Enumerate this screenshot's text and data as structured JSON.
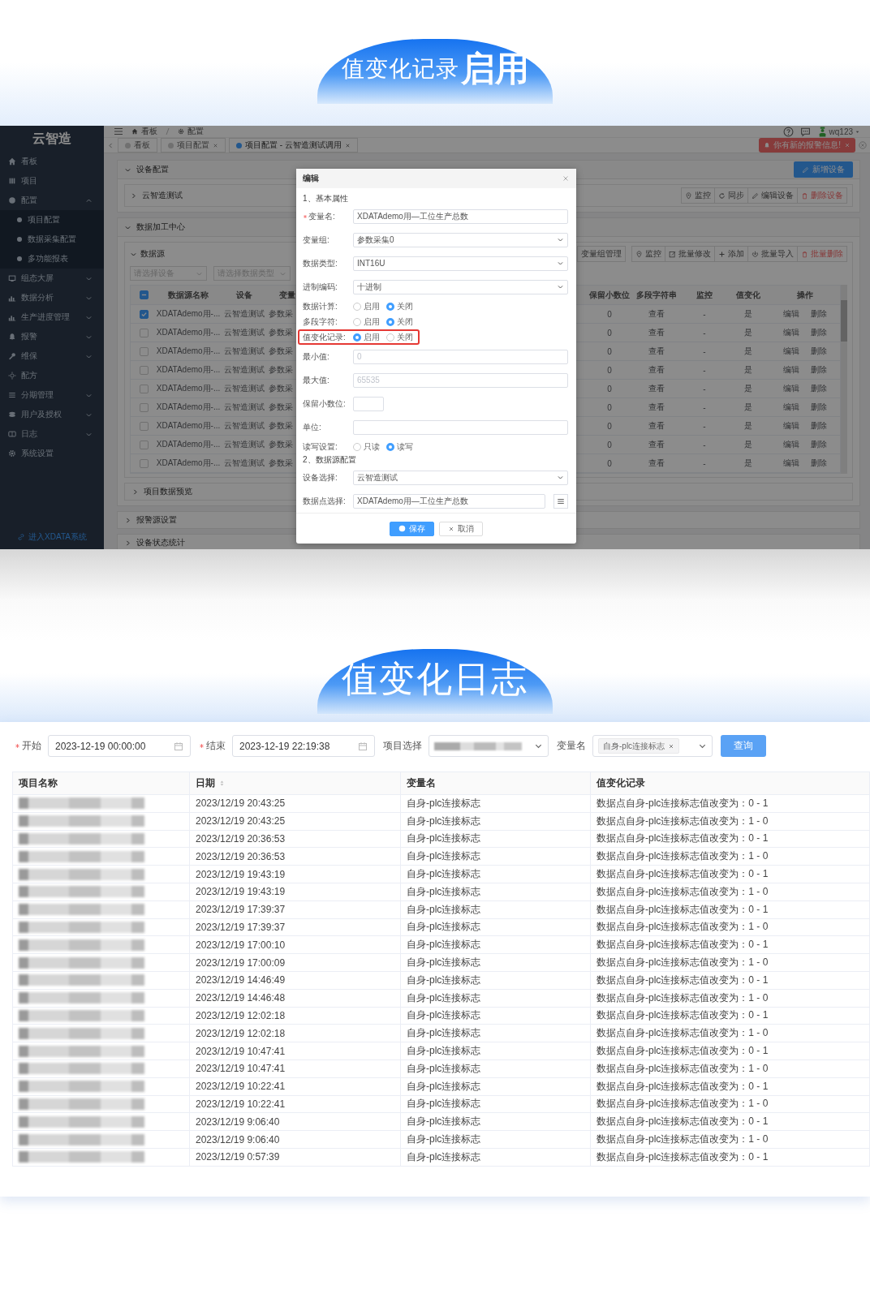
{
  "banner_top": {
    "title": "值变化记录",
    "emphasis": "启用"
  },
  "app": {
    "sidebar": {
      "logo": "云智造",
      "items": [
        {
          "label": "看板"
        },
        {
          "label": "项目"
        },
        {
          "label": "配置",
          "expanded": true,
          "children": [
            {
              "label": "项目配置"
            },
            {
              "label": "数据采集配置"
            },
            {
              "label": "多功能报表"
            }
          ]
        },
        {
          "label": "组态大屏",
          "expanded": false
        },
        {
          "label": "数据分析",
          "expanded": false
        },
        {
          "label": "生产进度管理",
          "expanded": false
        },
        {
          "label": "报警",
          "expanded": false
        },
        {
          "label": "维保",
          "expanded": false
        },
        {
          "label": "配方"
        },
        {
          "label": "分期管理",
          "expanded": false
        },
        {
          "label": "用户及授权",
          "expanded": false
        },
        {
          "label": "日志",
          "expanded": false
        },
        {
          "label": "系统设置"
        }
      ],
      "footer_link": "进入XDATA系统"
    },
    "breadcrumb": [
      "看板",
      "配置"
    ],
    "user": "wq123",
    "tabs": [
      {
        "label": "看板",
        "selected": false,
        "closable": false
      },
      {
        "label": "项目配置",
        "selected": false,
        "closable": true
      },
      {
        "label": "项目配置 - 云智造测试调用",
        "selected": true,
        "closable": true
      }
    ],
    "alert": "你有新的报警信息!",
    "device_section": {
      "title": "设备配置",
      "expanded": true,
      "button": "新增设备",
      "device": "云智造测试",
      "actions": [
        {
          "label": "监控",
          "kind": "normal"
        },
        {
          "label": "同步",
          "kind": "normal"
        },
        {
          "label": "编辑设备",
          "kind": "normal"
        },
        {
          "label": "删除设备",
          "kind": "danger"
        }
      ]
    },
    "data_section": {
      "title": "数据加工中心",
      "expanded": true,
      "source_title": "数据源",
      "group_button": "变量组管理",
      "actions": [
        {
          "label": "监控",
          "kind": "normal"
        },
        {
          "label": "批量修改",
          "kind": "normal"
        },
        {
          "label": "添加",
          "kind": "normal"
        },
        {
          "label": "批量导入",
          "kind": "normal"
        },
        {
          "label": "批量删除",
          "kind": "danger"
        }
      ],
      "header_indeterminate": true,
      "filters": [
        {
          "placeholder": "请选择设备"
        },
        {
          "placeholder": "请选择数据类型"
        }
      ],
      "columns_left": [
        "数据源名称",
        "设备",
        "变量"
      ],
      "columns_right": [
        "保留小数位",
        "多段字符串",
        "监控",
        "值变化",
        "操作"
      ],
      "rows": [
        {
          "selected": true,
          "name": "XDATAdemo用-...",
          "device": "云智造测试",
          "group": "参数采",
          "decimals": "0",
          "multi": "查看",
          "monitor": "-",
          "change": "是",
          "actions": [
            "编辑",
            "删除"
          ]
        },
        {
          "selected": false,
          "name": "XDATAdemo用-...",
          "device": "云智造测试",
          "group": "参数采",
          "decimals": "0",
          "multi": "查看",
          "monitor": "-",
          "change": "是",
          "actions": [
            "编辑",
            "删除"
          ]
        },
        {
          "selected": false,
          "name": "XDATAdemo用-...",
          "device": "云智造测试",
          "group": "参数采",
          "decimals": "0",
          "multi": "查看",
          "monitor": "-",
          "change": "是",
          "actions": [
            "编辑",
            "删除"
          ]
        },
        {
          "selected": false,
          "name": "XDATAdemo用-...",
          "device": "云智造测试",
          "group": "参数采",
          "decimals": "0",
          "multi": "查看",
          "monitor": "-",
          "change": "是",
          "actions": [
            "编辑",
            "删除"
          ]
        },
        {
          "selected": false,
          "name": "XDATAdemo用-...",
          "device": "云智造测试",
          "group": "参数采",
          "decimals": "0",
          "multi": "查看",
          "monitor": "-",
          "change": "是",
          "actions": [
            "编辑",
            "删除"
          ]
        },
        {
          "selected": false,
          "name": "XDATAdemo用-...",
          "device": "云智造测试",
          "group": "参数采",
          "decimals": "0",
          "multi": "查看",
          "monitor": "-",
          "change": "是",
          "actions": [
            "编辑",
            "删除"
          ]
        },
        {
          "selected": false,
          "name": "XDATAdemo用-...",
          "device": "云智造测试",
          "group": "参数采",
          "decimals": "0",
          "multi": "查看",
          "monitor": "-",
          "change": "是",
          "actions": [
            "编辑",
            "删除"
          ]
        },
        {
          "selected": false,
          "name": "XDATAdemo用-...",
          "device": "云智造测试",
          "group": "参数采",
          "decimals": "0",
          "multi": "查看",
          "monitor": "-",
          "change": "是",
          "actions": [
            "编辑",
            "删除"
          ]
        },
        {
          "selected": false,
          "name": "XDATAdemo用-...",
          "device": "云智造测试",
          "group": "参数采",
          "decimals": "0",
          "multi": "查看",
          "monitor": "-",
          "change": "是",
          "actions": [
            "编辑",
            "删除"
          ]
        }
      ],
      "preview": "项目数据预览"
    },
    "collapsed_sections": [
      "报警源设置",
      "设备状态统计"
    ],
    "dialog": {
      "title": "编辑",
      "sections": [
        {
          "title": "1、基本属性",
          "fields": [
            {
              "kind": "input",
              "label": "变量名:",
              "required": true,
              "highlighted": false,
              "value": "XDATAdemo用—工位生产总数"
            },
            {
              "kind": "select",
              "label": "变量组:",
              "required": false,
              "highlighted": false,
              "value": "参数采集0"
            },
            {
              "kind": "select",
              "label": "数据类型:",
              "required": false,
              "highlighted": false,
              "value": "INT16U"
            },
            {
              "kind": "select",
              "label": "进制编码:",
              "required": false,
              "highlighted": false,
              "value": "十进制"
            },
            {
              "kind": "radio",
              "label": "数据计算:",
              "required": false,
              "highlighted": false,
              "options": [
                {
                  "label": "启用",
                  "selected": false
                },
                {
                  "label": "关闭",
                  "selected": true
                }
              ]
            },
            {
              "kind": "radio",
              "label": "多段字符:",
              "required": false,
              "highlighted": false,
              "options": [
                {
                  "label": "启用",
                  "selected": false
                },
                {
                  "label": "关闭",
                  "selected": true
                }
              ]
            },
            {
              "kind": "radio",
              "label": "值变化记录:",
              "required": false,
              "highlighted": true,
              "options": [
                {
                  "label": "启用",
                  "selected": true
                },
                {
                  "label": "关闭",
                  "selected": false
                }
              ]
            },
            {
              "kind": "input",
              "label": "最小值:",
              "required": false,
              "highlighted": false,
              "placeholder": "0"
            },
            {
              "kind": "input",
              "label": "最大值:",
              "required": false,
              "highlighted": false,
              "placeholder": "65535"
            },
            {
              "kind": "short_input",
              "label": "保留小数位:",
              "required": false,
              "highlighted": false
            },
            {
              "kind": "input",
              "label": "单位:",
              "required": false,
              "highlighted": false
            },
            {
              "kind": "radio",
              "label": "读写设置:",
              "required": false,
              "highlighted": false,
              "options": [
                {
                  "label": "只读",
                  "selected": false
                },
                {
                  "label": "读写",
                  "selected": true
                }
              ]
            }
          ]
        },
        {
          "title": "2、数据源配置",
          "fields": [
            {
              "kind": "select",
              "label": "设备选择:",
              "required": false,
              "highlighted": false,
              "value": "云智造测试"
            },
            {
              "kind": "picker",
              "label": "数据点选择:",
              "required": false,
              "highlighted": false,
              "value": "XDATAdemo用—工位生产总数"
            }
          ]
        }
      ],
      "buttons": [
        {
          "label": "保存",
          "kind": "primary"
        },
        {
          "label": "取消",
          "kind": "cancel"
        }
      ]
    }
  },
  "banner_bottom": {
    "title": "值变化日志"
  },
  "log": {
    "filters": [
      {
        "kind": "date",
        "label": "开始",
        "required": true,
        "value": "2023-12-19 00:00:00"
      },
      {
        "kind": "date",
        "label": "结束",
        "required": true,
        "value": "2023-12-19 22:19:38"
      },
      {
        "kind": "select",
        "label": "项目选择",
        "required": false
      },
      {
        "kind": "tags",
        "label": "变量名",
        "required": false,
        "tags": [
          "自身-plc连接标志"
        ]
      }
    ],
    "query_button": "查询",
    "columns": [
      {
        "label": "项目名称",
        "sortable": false
      },
      {
        "label": "日期",
        "sortable": true
      },
      {
        "label": "变量名",
        "sortable": false
      },
      {
        "label": "值变化记录",
        "sortable": false
      }
    ],
    "rows": [
      {
        "date": "2023/12/19 20:43:25",
        "variable": "自身-plc连接标志",
        "record": "数据点自身-plc连接标志值改变为：0 - 1"
      },
      {
        "date": "2023/12/19 20:43:25",
        "variable": "自身-plc连接标志",
        "record": "数据点自身-plc连接标志值改变为：1 - 0"
      },
      {
        "date": "2023/12/19 20:36:53",
        "variable": "自身-plc连接标志",
        "record": "数据点自身-plc连接标志值改变为：0 - 1"
      },
      {
        "date": "2023/12/19 20:36:53",
        "variable": "自身-plc连接标志",
        "record": "数据点自身-plc连接标志值改变为：1 - 0"
      },
      {
        "date": "2023/12/19 19:43:19",
        "variable": "自身-plc连接标志",
        "record": "数据点自身-plc连接标志值改变为：0 - 1"
      },
      {
        "date": "2023/12/19 19:43:19",
        "variable": "自身-plc连接标志",
        "record": "数据点自身-plc连接标志值改变为：1 - 0"
      },
      {
        "date": "2023/12/19 17:39:37",
        "variable": "自身-plc连接标志",
        "record": "数据点自身-plc连接标志值改变为：0 - 1"
      },
      {
        "date": "2023/12/19 17:39:37",
        "variable": "自身-plc连接标志",
        "record": "数据点自身-plc连接标志值改变为：1 - 0"
      },
      {
        "date": "2023/12/19 17:00:10",
        "variable": "自身-plc连接标志",
        "record": "数据点自身-plc连接标志值改变为：0 - 1"
      },
      {
        "date": "2023/12/19 17:00:09",
        "variable": "自身-plc连接标志",
        "record": "数据点自身-plc连接标志值改变为：1 - 0"
      },
      {
        "date": "2023/12/19 14:46:49",
        "variable": "自身-plc连接标志",
        "record": "数据点自身-plc连接标志值改变为：0 - 1"
      },
      {
        "date": "2023/12/19 14:46:48",
        "variable": "自身-plc连接标志",
        "record": "数据点自身-plc连接标志值改变为：1 - 0"
      },
      {
        "date": "2023/12/19 12:02:18",
        "variable": "自身-plc连接标志",
        "record": "数据点自身-plc连接标志值改变为：0 - 1"
      },
      {
        "date": "2023/12/19 12:02:18",
        "variable": "自身-plc连接标志",
        "record": "数据点自身-plc连接标志值改变为：1 - 0"
      },
      {
        "date": "2023/12/19 10:47:41",
        "variable": "自身-plc连接标志",
        "record": "数据点自身-plc连接标志值改变为：0 - 1"
      },
      {
        "date": "2023/12/19 10:47:41",
        "variable": "自身-plc连接标志",
        "record": "数据点自身-plc连接标志值改变为：1 - 0"
      },
      {
        "date": "2023/12/19 10:22:41",
        "variable": "自身-plc连接标志",
        "record": "数据点自身-plc连接标志值改变为：0 - 1"
      },
      {
        "date": "2023/12/19 10:22:41",
        "variable": "自身-plc连接标志",
        "record": "数据点自身-plc连接标志值改变为：1 - 0"
      },
      {
        "date": "2023/12/19 9:06:40",
        "variable": "自身-plc连接标志",
        "record": "数据点自身-plc连接标志值改变为：0 - 1"
      },
      {
        "date": "2023/12/19 9:06:40",
        "variable": "自身-plc连接标志",
        "record": "数据点自身-plc连接标志值改变为：1 - 0"
      },
      {
        "date": "2023/12/19 0:57:39",
        "variable": "自身-plc连接标志",
        "record": "数据点自身-plc连接标志值改变为：0 - 1"
      }
    ]
  }
}
